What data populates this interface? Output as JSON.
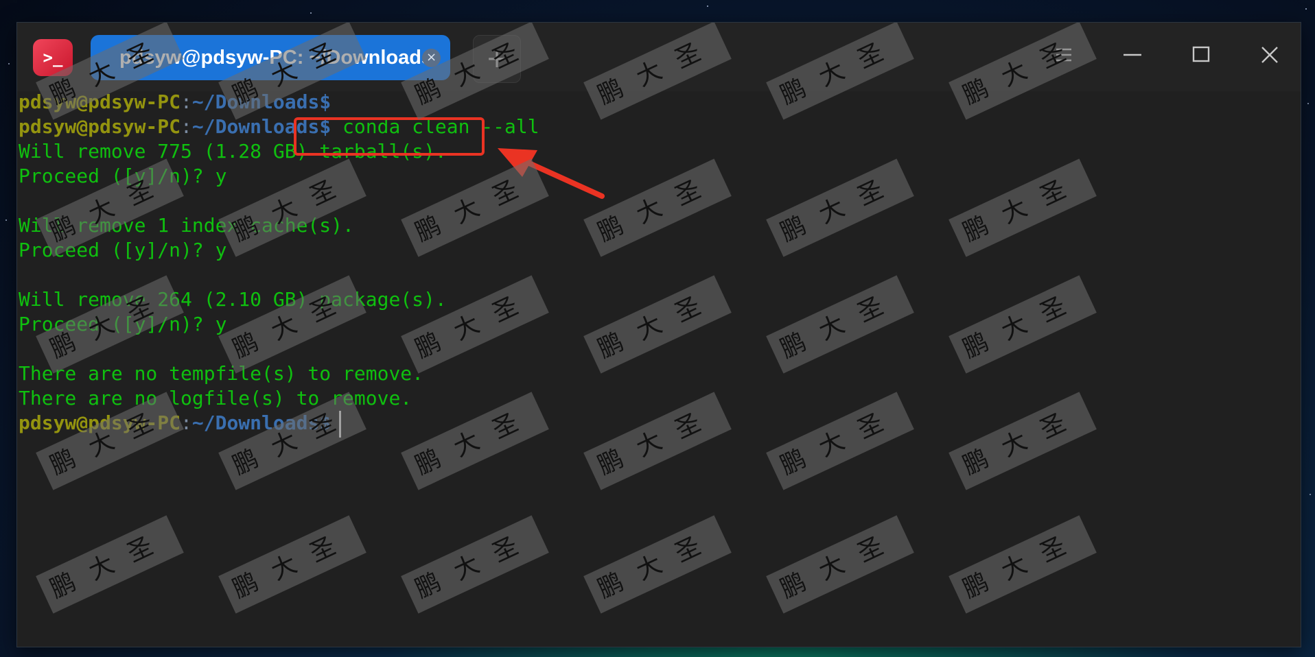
{
  "window": {
    "tab_title": "pdsyw@pdsyw-PC: ~/Downloads",
    "tab_close_glyph": "×",
    "new_tab_glyph": "+",
    "app_icon_glyph": ">_",
    "icons": [
      "terminal-app-icon",
      "menu-icon",
      "minimize-icon",
      "maximize-icon",
      "close-icon"
    ]
  },
  "terminal": {
    "prompt": {
      "user": "pdsyw@pdsyw-PC",
      "colon": ":",
      "path": "~/Downloads",
      "dollar": "$"
    },
    "command": "conda clean --all",
    "outputs": [
      "Will remove 775 (1.28 GB) tarball(s).",
      "Proceed ([y]/n)? y",
      "",
      "Will remove 1 index cache(s).",
      "Proceed ([y]/n)? y",
      "",
      "Will remove 264 (2.10 GB) package(s).",
      "Proceed ([y]/n)? y",
      "",
      "There are no tempfile(s) to remove.",
      "There are no logfile(s) to remove."
    ]
  },
  "colors": {
    "prompt_user": "#94940f",
    "prompt_path": "#3a6fb0",
    "output_text": "#0fc00f",
    "tab_active": "#1b74d9",
    "annotation_red": "#ea3323",
    "app_icon": "#e0303f"
  },
  "watermark_text": "鹏大圣"
}
